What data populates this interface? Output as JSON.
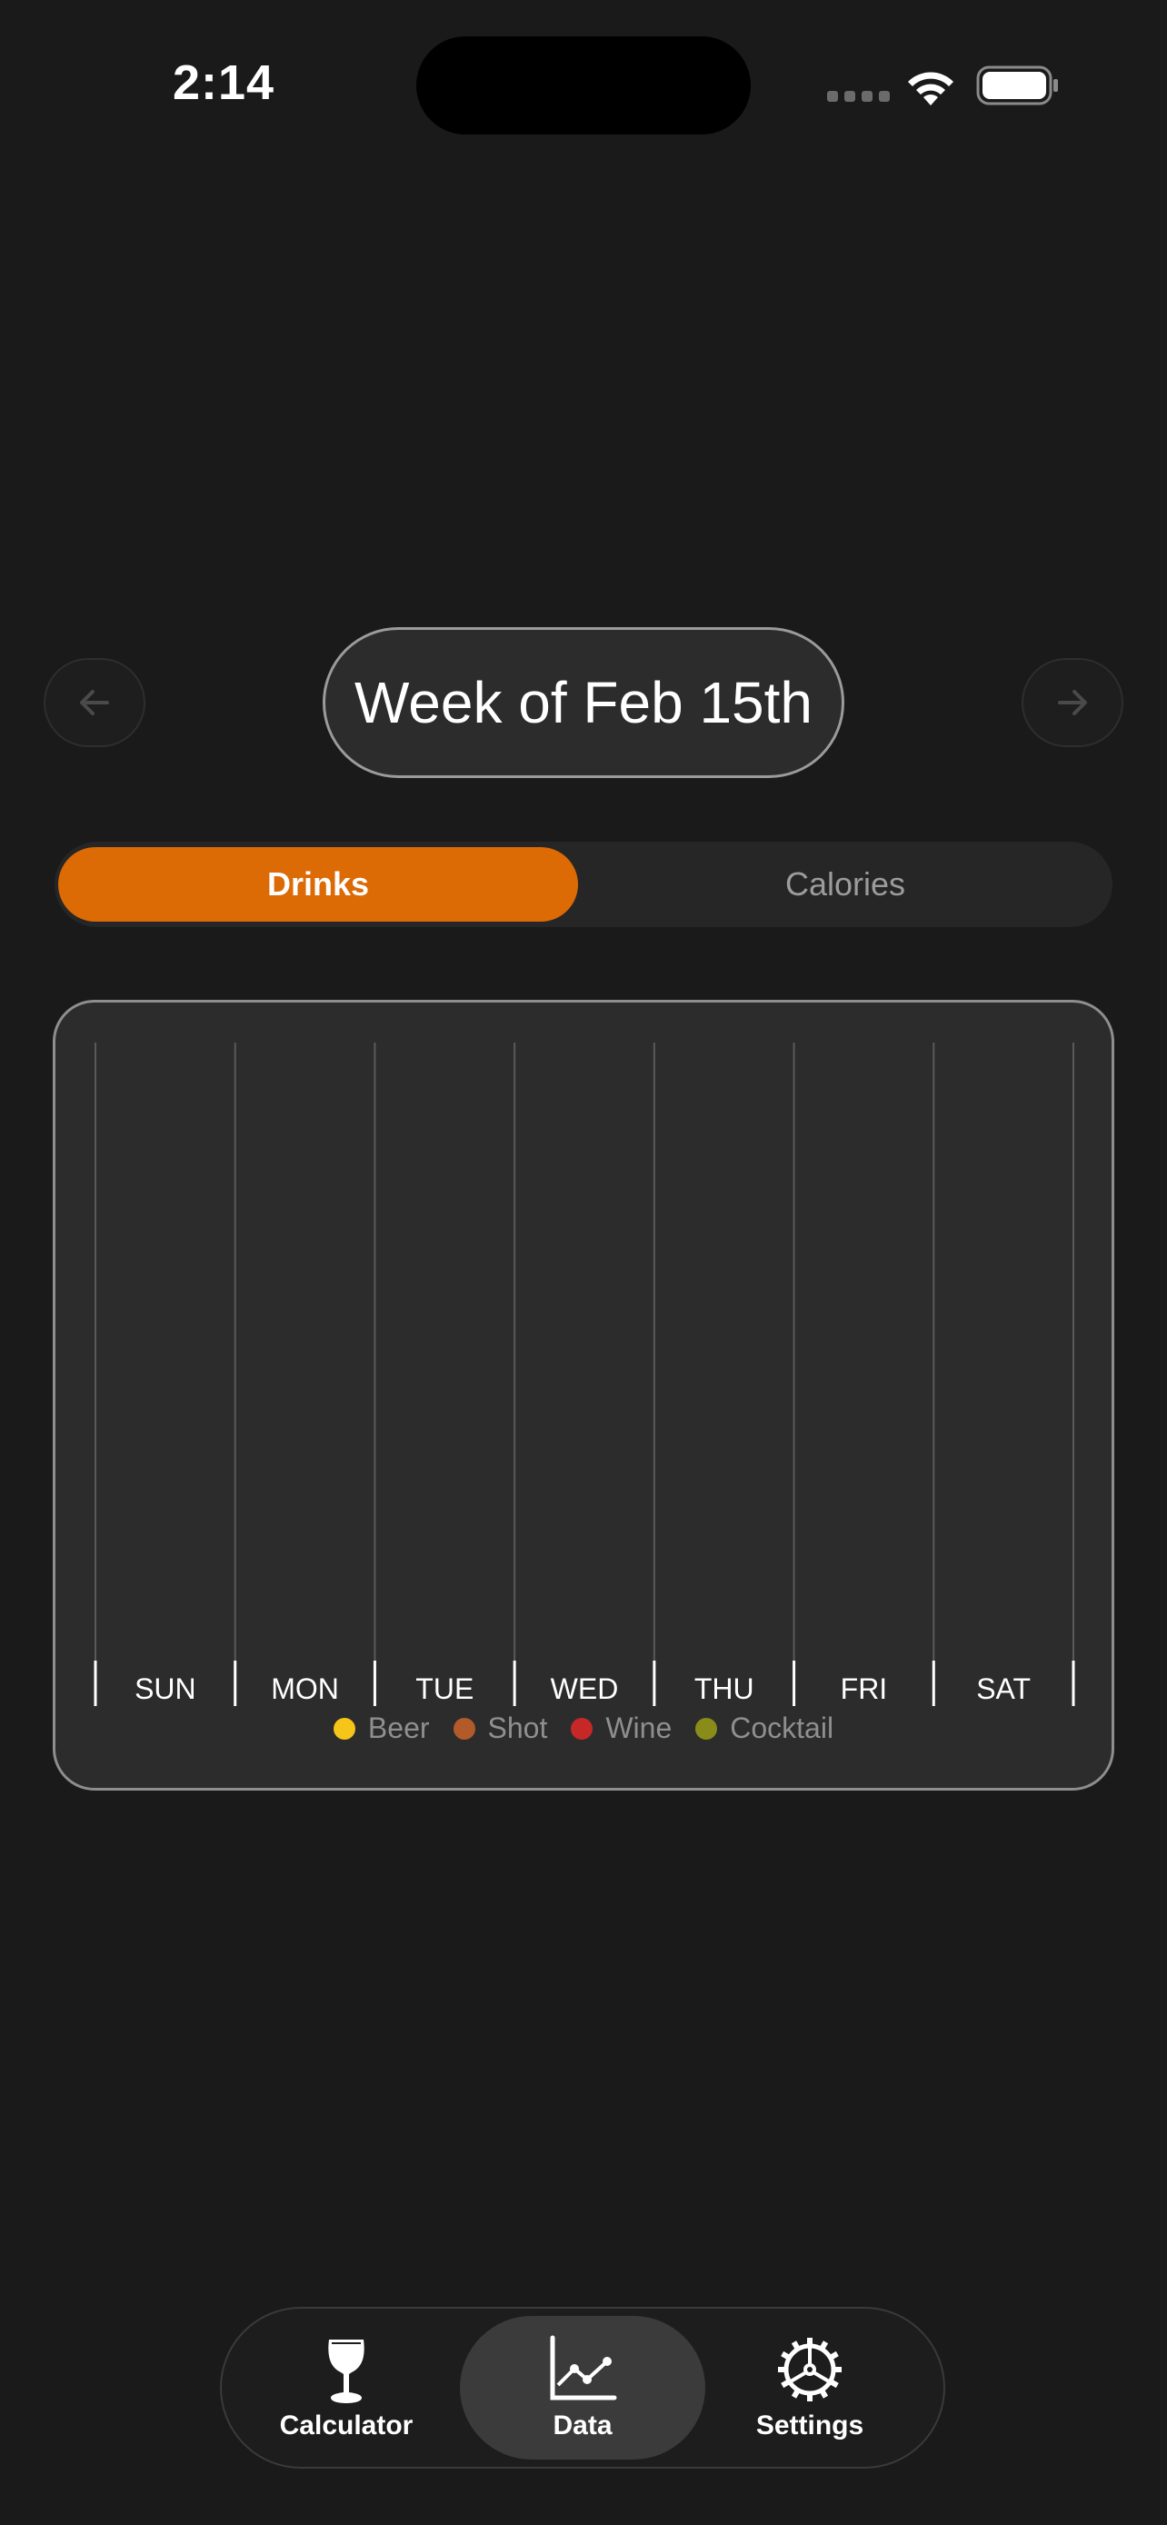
{
  "status_bar": {
    "time": "2:14"
  },
  "week_nav": {
    "title": "Week of Feb 15th",
    "prev_icon": "arrow-left-icon",
    "next_icon": "arrow-right-icon"
  },
  "segmented_control": {
    "options": [
      "Drinks",
      "Calories"
    ],
    "selected": "Drinks"
  },
  "chart_data": {
    "type": "bar",
    "categories": [
      "SUN",
      "MON",
      "TUE",
      "WED",
      "THU",
      "FRI",
      "SAT"
    ],
    "series": [
      {
        "name": "Beer",
        "color": "#f5c518",
        "values": [
          0,
          0,
          0,
          0,
          0,
          0,
          0
        ]
      },
      {
        "name": "Shot",
        "color": "#b35a2a",
        "values": [
          0,
          0,
          0,
          0,
          0,
          0,
          0
        ]
      },
      {
        "name": "Wine",
        "color": "#c62828",
        "values": [
          0,
          0,
          0,
          0,
          0,
          0,
          0
        ]
      },
      {
        "name": "Cocktail",
        "color": "#8a8c1a",
        "values": [
          0,
          0,
          0,
          0,
          0,
          0,
          0
        ]
      }
    ],
    "stacked": true,
    "grid": true,
    "legend_position": "bottom"
  },
  "tab_bar": {
    "tabs": [
      {
        "label": "Calculator",
        "icon": "wine-glass-icon",
        "active": false
      },
      {
        "label": "Data",
        "icon": "line-chart-icon",
        "active": true
      },
      {
        "label": "Settings",
        "icon": "gear-icon",
        "active": false
      }
    ]
  },
  "colors": {
    "accent": "#dc6a05",
    "background": "#1a1a1a",
    "card": "#2c2c2c"
  }
}
